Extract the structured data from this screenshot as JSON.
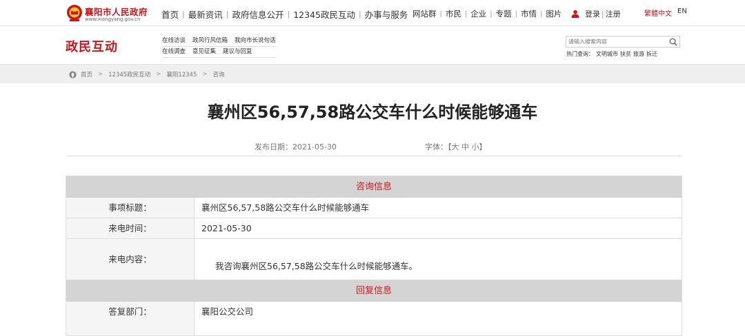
{
  "brand": {
    "name": "襄阳市人民政府",
    "url": "www.xiangyang.gov.cn"
  },
  "main_nav": [
    "首页",
    "最新资讯",
    "政府信息公开",
    "12345政民互动",
    "办事与服务"
  ],
  "sub_nav": [
    "网站群",
    "市民",
    "企业",
    "专题",
    "市情",
    "图片"
  ],
  "user": {
    "login": "登录",
    "register": "注册"
  },
  "lang": {
    "traditional": "繁體中文",
    "english": "EN"
  },
  "section": {
    "title": "政民互动",
    "links_row1": [
      "在线访谈",
      "政风行风信箱",
      "我向市长说句话"
    ],
    "links_row2": [
      "在线调查",
      "意见征集",
      "建议与回复"
    ]
  },
  "search": {
    "placeholder": "请输入搜索内容"
  },
  "hot": {
    "label": "热门查询：",
    "items": [
      "文明城市",
      "扶贫",
      "旅游",
      "拆迁"
    ]
  },
  "breadcrumb": [
    "首页",
    "12345政民互动",
    "襄阳12345",
    "咨询"
  ],
  "article": {
    "title": "襄州区56,57,58路公交车什么时候能够通车",
    "date": "发布日期：2021-05-30",
    "font_prefix": "字体：【",
    "font_large": "大",
    "font_medium": "中",
    "font_small": "小",
    "font_suffix": "】"
  },
  "consult": {
    "header": "咨询信息",
    "subject_label": "事项标题：",
    "subject_value": "襄州区56,57,58路公交车什么时候能够通车",
    "time_label": "来电时间：",
    "time_value": "2021-05-30",
    "content_label": "来电内容：",
    "content_value": "我咨询襄州区56,57,58路公交车什么时候能够通车。"
  },
  "reply": {
    "header": "回复信息",
    "dept_label": "答复部门：",
    "dept_value": "襄阳公交公司"
  },
  "colors": {
    "brand_red": "#c8171d",
    "section_bg": "#d4d4d4",
    "label_bg": "#f5f5f5"
  },
  "icons": [
    "emblem-icon",
    "user-icon",
    "search-icon",
    "home-icon"
  ]
}
